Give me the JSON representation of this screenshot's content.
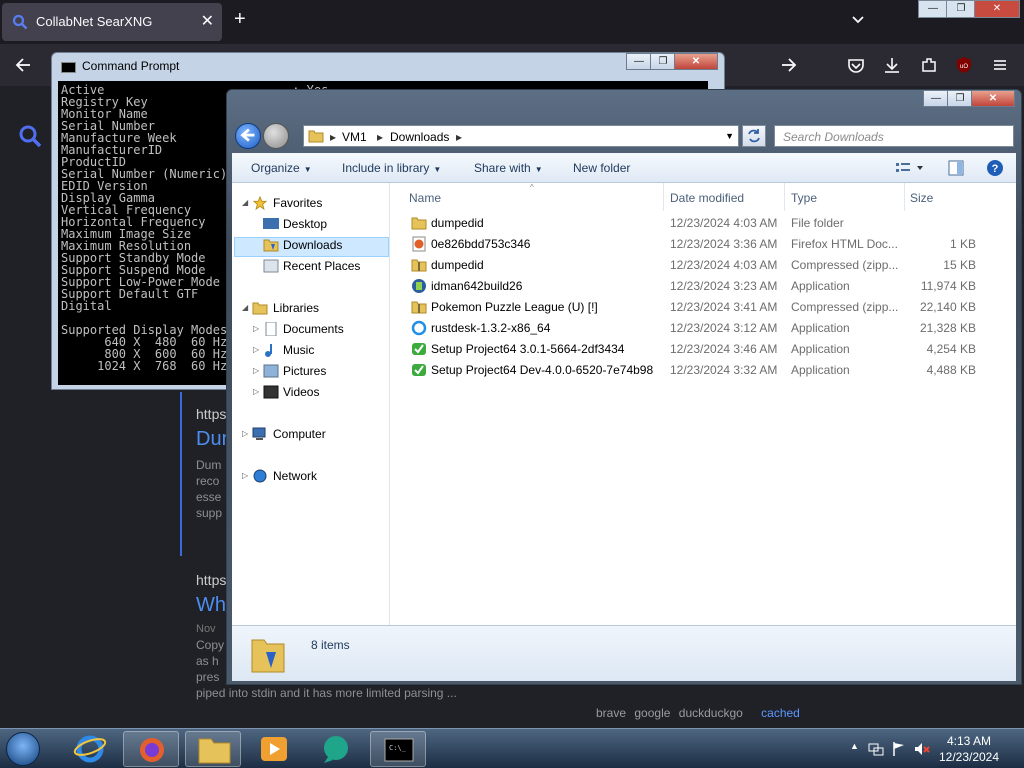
{
  "browser": {
    "tab_title": "CollabNet SearXNG",
    "new_tab_glyph": "+",
    "tab_close_glyph": "✕",
    "list_all_glyph": "⌄",
    "window_buttons": [
      "—",
      "❐",
      "✕"
    ]
  },
  "searx": {
    "result1": {
      "url": "https:",
      "title": "Dun",
      "desc": [
        "Dum",
        "reco",
        "esse",
        "supp"
      ]
    },
    "result2": {
      "url": "https:",
      "title": "Wh",
      "date": "Nov",
      "desc": [
        "Copy",
        "as h",
        "pres",
        "piped into stdin and it has more limited parsing ..."
      ]
    },
    "footer": {
      "engines": [
        "brave",
        "google",
        "duckduckgo"
      ],
      "cached": "cached"
    }
  },
  "cmd": {
    "title": "Command Prompt",
    "lines": [
      "Active                          : Yes",
      "Registry Key",
      "Monitor Name",
      "Serial Number",
      "Manufacture Week",
      "ManufacturerID",
      "ProductID",
      "Serial Number (Numeric)",
      "EDID Version",
      "Display Gamma",
      "Vertical Frequency",
      "Horizontal Frequency",
      "Maximum Image Size",
      "Maximum Resolution",
      "Support Standby Mode",
      "Support Suspend Mode",
      "Support Low-Power Mode",
      "Support Default GTF",
      "Digital",
      "",
      "Supported Display Modes",
      "      640 X  480  60 Hz",
      "      800 X  600  60 Hz",
      "     1024 X  768  60 Hz"
    ]
  },
  "explorer": {
    "breadcrumb": [
      "VM1",
      "Downloads"
    ],
    "search_placeholder": "Search Downloads",
    "toolbar": {
      "organize": "Organize",
      "include": "Include in library",
      "share": "Share with",
      "new_folder": "New folder"
    },
    "nav": {
      "favorites": "Favorites",
      "desktop": "Desktop",
      "downloads": "Downloads",
      "recent": "Recent Places",
      "libraries": "Libraries",
      "documents": "Documents",
      "music": "Music",
      "pictures": "Pictures",
      "videos": "Videos",
      "computer": "Computer",
      "network": "Network"
    },
    "columns": {
      "name": "Name",
      "date": "Date modified",
      "type": "Type",
      "size": "Size"
    },
    "files": [
      {
        "name": "dumpedid",
        "date": "12/23/2024 4:03 AM",
        "type": "File folder",
        "size": ""
      },
      {
        "name": "0e826bdd753c346",
        "date": "12/23/2024 3:36 AM",
        "type": "Firefox HTML Doc...",
        "size": "1 KB"
      },
      {
        "name": "dumpedid",
        "date": "12/23/2024 4:03 AM",
        "type": "Compressed (zipp...",
        "size": "15 KB"
      },
      {
        "name": "idman642build26",
        "date": "12/23/2024 3:23 AM",
        "type": "Application",
        "size": "11,974 KB"
      },
      {
        "name": "Pokemon Puzzle League (U) [!]",
        "date": "12/23/2024 3:41 AM",
        "type": "Compressed (zipp...",
        "size": "22,140 KB"
      },
      {
        "name": "rustdesk-1.3.2-x86_64",
        "date": "12/23/2024 3:12 AM",
        "type": "Application",
        "size": "21,328 KB"
      },
      {
        "name": "Setup Project64 3.0.1-5664-2df3434",
        "date": "12/23/2024 3:46 AM",
        "type": "Application",
        "size": "4,254 KB"
      },
      {
        "name": "Setup Project64 Dev-4.0.0-6520-7e74b98",
        "date": "12/23/2024 3:32 AM",
        "type": "Application",
        "size": "4,488 KB"
      }
    ],
    "item_count": "8 items"
  },
  "taskbar": {
    "time": "4:13 AM",
    "date": "12/23/2024"
  }
}
